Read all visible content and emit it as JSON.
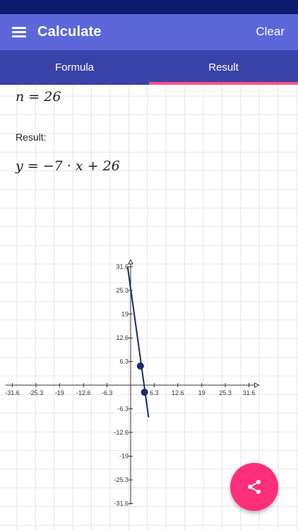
{
  "app_bar": {
    "title": "Calculate",
    "clear_label": "Clear"
  },
  "tabs": [
    {
      "label": "Formula"
    },
    {
      "label": "Result",
      "active": true
    }
  ],
  "equation_param": "n = 26",
  "result_label": "Result:",
  "result_formula": "y = −7 · x + 26",
  "colors": {
    "app_bar": "#5d67d9",
    "tabs": "#3942a8",
    "tab_indicator": "#ff4f8b",
    "fab": "#ff2e7a",
    "line": "#1c2a66"
  },
  "chart_data": {
    "type": "line",
    "series": [
      {
        "points": [
          [
            -0.8,
            31.6
          ],
          [
            4.8,
            -8.6
          ]
        ]
      }
    ],
    "marked_points": [
      [
        2.6,
        5.1
      ],
      [
        3.7,
        -1.9
      ]
    ],
    "x_ticks": [
      "-31.6",
      "-25.3",
      "-19",
      "-12.6",
      "-6.3",
      "6.3",
      "12.6",
      "19",
      "25.3",
      "31.6"
    ],
    "y_ticks": [
      "31.6",
      "25.3",
      "19",
      "12.6",
      "6.3",
      "-6.3",
      "-12.6",
      "-19",
      "-25.3",
      "-31.6"
    ],
    "xlim": [
      -31.6,
      31.6
    ],
    "ylim": [
      -31.6,
      31.6
    ],
    "grid": true
  },
  "fab_icon": "share-icon"
}
